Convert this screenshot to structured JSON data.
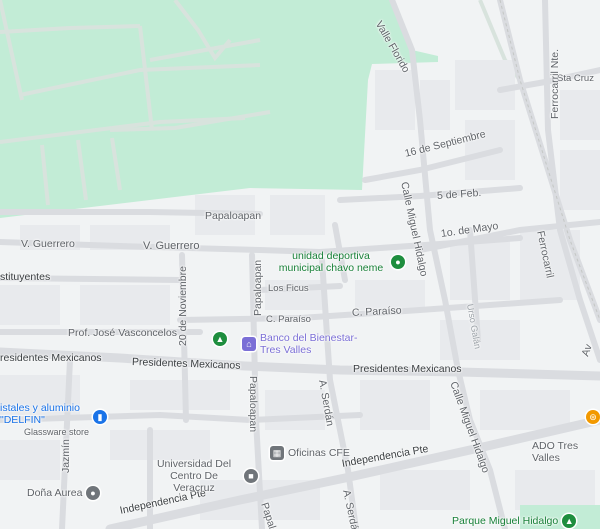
{
  "colors": {
    "park": "#c2ecd6",
    "land": "#f1f3f4",
    "road": "#dadce0",
    "block": "#e8eaed",
    "poi_green": "#1e8e3e",
    "poi_blue": "#1a73e8",
    "poi_purple": "#7b6fd6",
    "poi_gray": "#70757a",
    "poi_orange": "#f29900",
    "park_label": "#188038",
    "store_label": "#1a73e8"
  },
  "streets": {
    "valle_florido": "Valle Florido",
    "sta_cruz": "Sta Cruz",
    "ferrocarril_nte": "Ferrocarril Nte.",
    "ferrocarril": "Ferrocarril",
    "dieciseis_septiembre": "16 de Septiembre",
    "cinco_feb": "5 de Feb.",
    "uno_mayo": "1o. de Mayo",
    "miguel_hidalgo_north": "Calle Miguel Hidalgo",
    "miguel_hidalgo_south": "Calle Miguel Hidalgo",
    "papaloapan_h": "Papaloapan",
    "papaloapan_v1": "Papaloapan",
    "papaloapan_v2": "Papaloapan",
    "papaloapan_v3": "Papalo",
    "v_guerrero_left": "V. Guerrero",
    "v_guerrero": "V. Guerrero",
    "constituyentes": "stituyentes",
    "veinte_noviembre": "20 de Noviembre",
    "los_ficus": "Los Ficus",
    "c_paraiso_left": "C. Paraíso",
    "c_paraiso_right": "C. Paraíso",
    "prof_vasconcelos": "Prof. José Vasconcelos",
    "presidentes_left": "residentes Mexicanos",
    "presidentes_mid": "Presidentes Mexicanos",
    "presidentes_right": "Presidentes Mexicanos",
    "a_serdan_1": "A. Serdán",
    "a_serdan_2": "A. Serdán",
    "independencia_right": "Independencia Pte",
    "independencia_left": "Independencia Pte",
    "jazmin": "Jazmín",
    "urso_galan": "Urso Galán",
    "ave": "Av"
  },
  "pois": {
    "unidad_deportiva": "unidad deportiva municipal chavo neme",
    "banco": "Banco del Bienestar-Tres Valles",
    "cristales": "istales y aluminio \"DELFIN\"",
    "cristales_sub": "Glassware store",
    "universidad": "Universidad Del Centro De Veracruz",
    "oficinas_cfe": "Oficinas CFE",
    "ado": "ADO Tres Valles",
    "dona_aurea": "Doña Aurea",
    "parque_hidalgo": "Parque Miguel Hidalgo"
  },
  "icons": {
    "park_pin": "park-icon",
    "monument_pin": "monument-icon",
    "bank_pin": "bank-icon",
    "store_pin": "shopping-bag-icon",
    "school_pin": "school-icon",
    "office_pin": "office-icon",
    "restaurant_pin": "restaurant-icon",
    "place_pin": "place-icon"
  }
}
